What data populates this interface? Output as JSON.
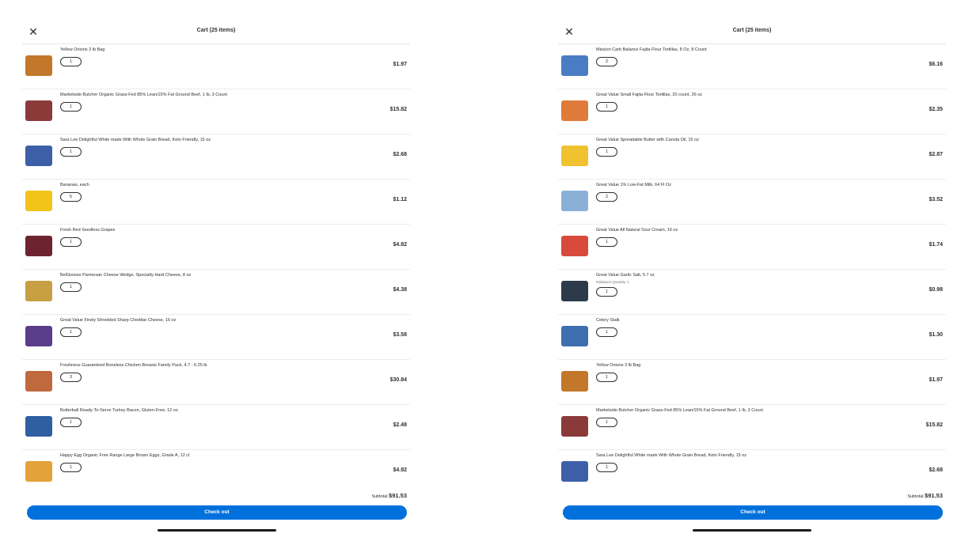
{
  "left": {
    "title": "Cart (25 items)",
    "items": [
      {
        "name": "Yellow Onions 3 lb Bag",
        "qty": "1",
        "price": "$1.97",
        "color": "#c2772b"
      },
      {
        "name": "Marketside Butcher Organic Grass-Fed 85% Lean/15% Fat Ground Beef, 1 lb, 3 Count",
        "qty": "1",
        "price": "$15.82",
        "color": "#8b3a3a"
      },
      {
        "name": "Sara Lee Delightful White made With Whole Grain Bread, Keto Friendly, 15 oz",
        "qty": "1",
        "price": "$2.68",
        "color": "#3d5fa8"
      },
      {
        "name": "Bananas, each",
        "qty": "5",
        "price": "$1.12",
        "color": "#f2c41a"
      },
      {
        "name": "Fresh Red Seedless Grapes",
        "qty": "1",
        "price": "$4.82",
        "color": "#6d2430"
      },
      {
        "name": "BelGioioso Parmesan Cheese Wedge, Specialty Hard Cheese, 8 oz",
        "qty": "1",
        "price": "$4.38",
        "color": "#c7a043"
      },
      {
        "name": "Great Value Finely Shredded Sharp Cheddar Cheese, 16 oz",
        "qty": "1",
        "price": "$3.58",
        "color": "#5a3d8a"
      },
      {
        "name": "Freshness Guaranteed Boneless Chicken Breasts Family Pack, 4.7 - 6.25 lb",
        "qty": "3",
        "price": "$30.84",
        "color": "#c0683e"
      },
      {
        "name": "Butterball Ready-To-Serve Turkey Bacon, Gluten-Free, 12 oz.",
        "qty": "1",
        "price": "$2.48",
        "color": "#2f5fa0"
      },
      {
        "name": "Happy Egg Organic Free Range Large Brown Eggs, Grade A, 12 ct",
        "qty": "1",
        "price": "$4.92",
        "color": "#e4a23a"
      }
    ],
    "subtotal_label": "Subtotal",
    "subtotal_value": "$91.53",
    "checkout_label": "Check out"
  },
  "right": {
    "title": "Cart (25 items)",
    "items": [
      {
        "name": "Mission Carb Balance Fajita Flour Tortillas, 8 Oz, 8 Count",
        "qty": "2",
        "price": "$6.16",
        "color": "#4a7cc4"
      },
      {
        "name": "Great Value Small Fajita Flour Tortillas, 20 count, 26 oz",
        "qty": "1",
        "price": "$2.35",
        "color": "#e07a3a"
      },
      {
        "name": "Great Value Spreadable Butter with Canola Oil, 15 oz",
        "qty": "1",
        "price": "$2.87",
        "color": "#f0c230"
      },
      {
        "name": "Great Value 1% Low-Fat Milk, 64 Fl Oz",
        "qty": "2",
        "price": "$3.52",
        "color": "#8ab0d8"
      },
      {
        "name": "Great Value All Natural Sour Cream, 16 oz",
        "qty": "1",
        "price": "$1.74",
        "color": "#d94a3a"
      },
      {
        "name": "Great Value Garlic Salt, 5.7 oz",
        "sub": "Multipack Quantity: 1",
        "qty": "1",
        "price": "$0.98",
        "color": "#2d3a4a"
      },
      {
        "name": "Celery Stalk",
        "qty": "1",
        "price": "$1.30",
        "color": "#3f6fb0"
      },
      {
        "name": "Yellow Onions 3 lb Bag",
        "qty": "1",
        "price": "$1.97",
        "color": "#c2772b"
      },
      {
        "name": "Marketside Butcher Organic Grass-Fed 85% Lean/15% Fat Ground Beef, 1 lb, 3 Count",
        "qty": "1",
        "price": "$15.82",
        "color": "#8b3a3a"
      },
      {
        "name": "Sara Lee Delightful White made With Whole Grain Bread, Keto Friendly, 15 oz",
        "qty": "1",
        "price": "$2.68",
        "color": "#3d5fa8"
      }
    ],
    "subtotal_label": "Subtotal",
    "subtotal_value": "$91.53",
    "checkout_label": "Check out"
  }
}
